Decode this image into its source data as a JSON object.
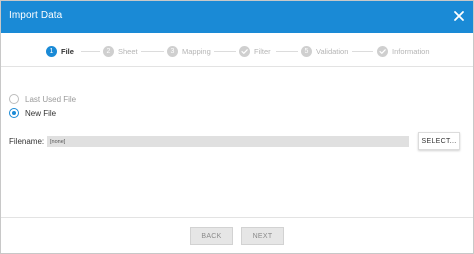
{
  "dialog": {
    "title": "Import Data",
    "close_icon": "close-icon",
    "accent_color": "#1a8ad6"
  },
  "stepper": {
    "steps": [
      {
        "number": "1",
        "label": "File",
        "state": "active"
      },
      {
        "number": "2",
        "label": "Sheet",
        "state": "pending"
      },
      {
        "number": "3",
        "label": "Mapping",
        "state": "pending"
      },
      {
        "number": "",
        "label": "Filter",
        "state": "done",
        "icon": "check-icon"
      },
      {
        "number": "5",
        "label": "Validation",
        "state": "pending"
      },
      {
        "number": "",
        "label": "Information",
        "state": "done",
        "icon": "check-icon"
      }
    ]
  },
  "source": {
    "options": [
      {
        "label": "Last Used File",
        "checked": false
      },
      {
        "label": "New File",
        "checked": true
      }
    ]
  },
  "file": {
    "label": "Filename:",
    "value": "[none]",
    "select_label": "SELECT..."
  },
  "footer": {
    "back_label": "BACK",
    "next_label": "NEXT"
  }
}
